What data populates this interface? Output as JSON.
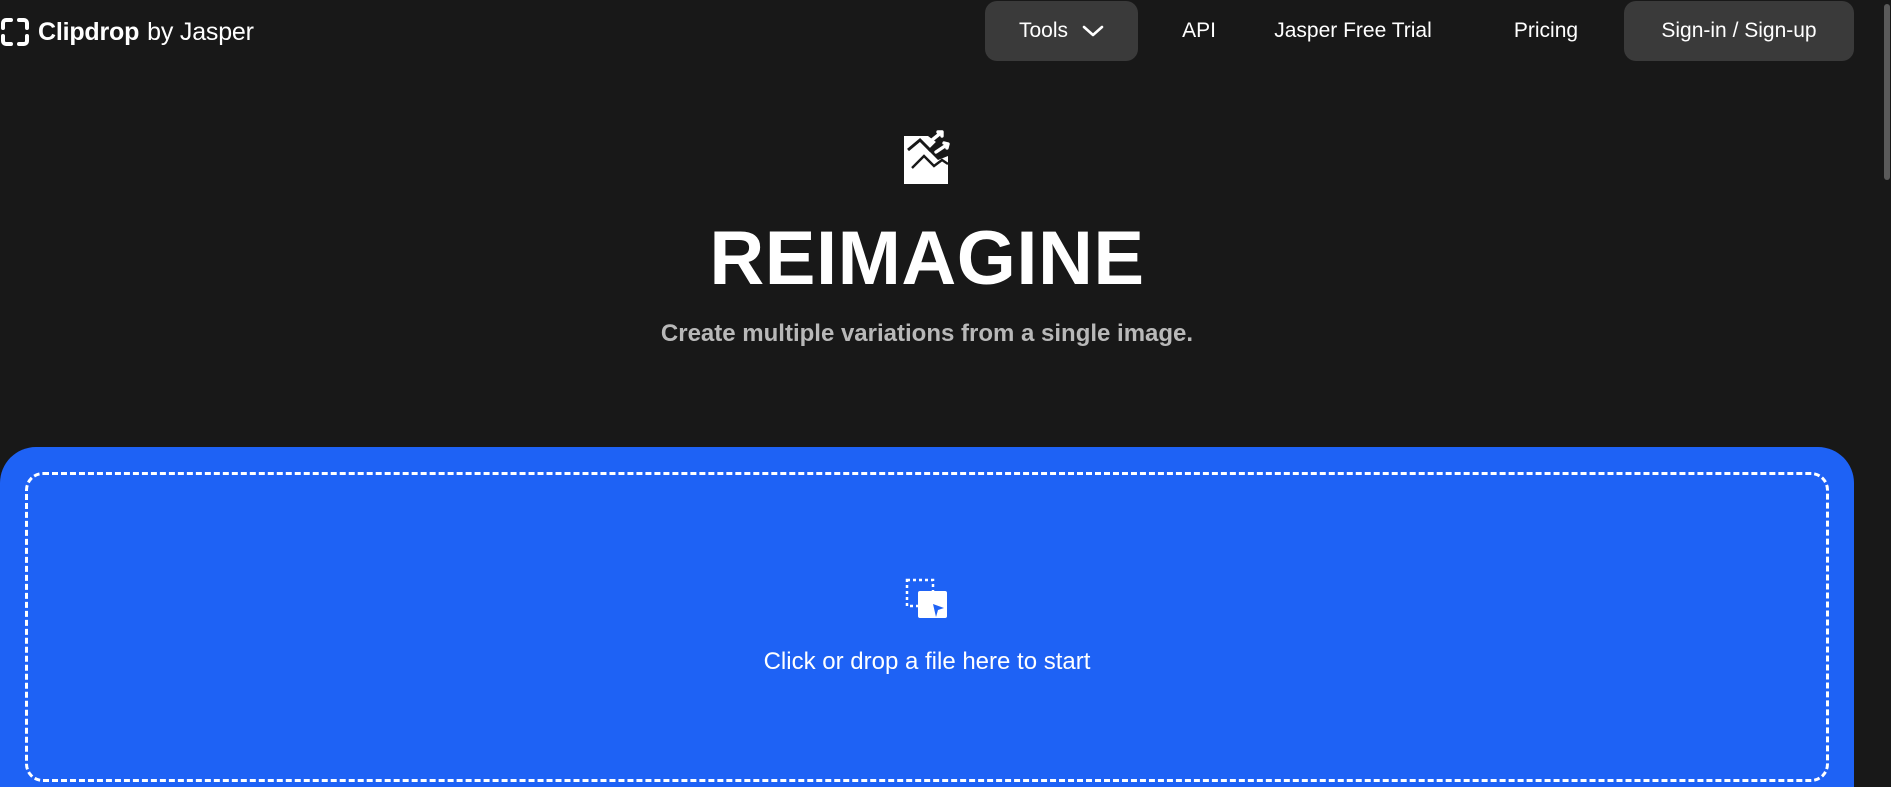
{
  "header": {
    "logo_brand": "Clipdrop",
    "logo_by": "by Jasper",
    "nav": {
      "tools": "Tools",
      "api": "API",
      "trial": "Jasper Free Trial",
      "pricing": "Pricing",
      "signin": "Sign-in / Sign-up"
    }
  },
  "hero": {
    "icon": "reimagine-icon",
    "title": "REIMAGINE",
    "subtitle": "Create multiple variations from a single image."
  },
  "dropzone": {
    "icon": "upload-file-icon",
    "text": "Click or drop a file here to start"
  },
  "colors": {
    "background": "#181818",
    "accent": "#1e62f5",
    "nav_button_bg": "#3a3a3a",
    "subtitle": "#b8b8b8"
  }
}
